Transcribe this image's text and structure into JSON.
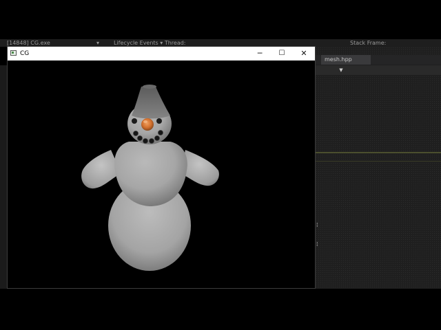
{
  "ide": {
    "topbar": {
      "process": "[14848] CG.exe",
      "event_filter": "Lifecycle Events ▾ Thread:",
      "stack": "Stack Frame:"
    },
    "file_tab": "mesh.hpp"
  },
  "window": {
    "title": "CG",
    "minimize": "─",
    "maximize": "☐",
    "close": "✕"
  },
  "scene": {
    "subject": "snowman",
    "body_color": "#a8a8a8",
    "nose_color": "#d2702e"
  }
}
